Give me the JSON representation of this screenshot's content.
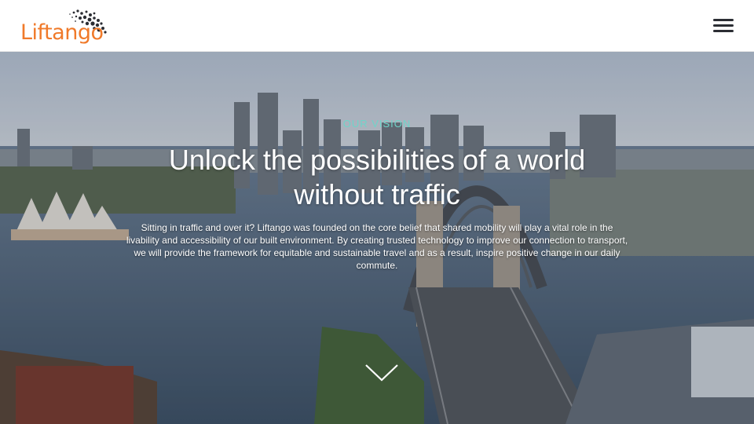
{
  "header": {
    "logo_text_1": "Lift",
    "logo_text_2": "ango",
    "menu_icon": "hamburger-menu-icon"
  },
  "hero": {
    "eyebrow": "OUR VISION",
    "headline": "Unlock the possibilities of a world without traffic",
    "intro": "Sitting in traffic and over it?  Liftango was founded on the core belief that shared mobility will play a vital role in the livability and accessibility of our built environment. By creating trusted technology to improve our connection to transport, we will provide the framework for equitable and sustainable travel and as a result, inspire positive change in our daily commute.",
    "scroll_icon": "chevron-down-icon"
  },
  "colors": {
    "brand_orange": "#f07a2a",
    "accent_teal": "#6fd4c9",
    "menu_dark": "#2b2d33"
  }
}
